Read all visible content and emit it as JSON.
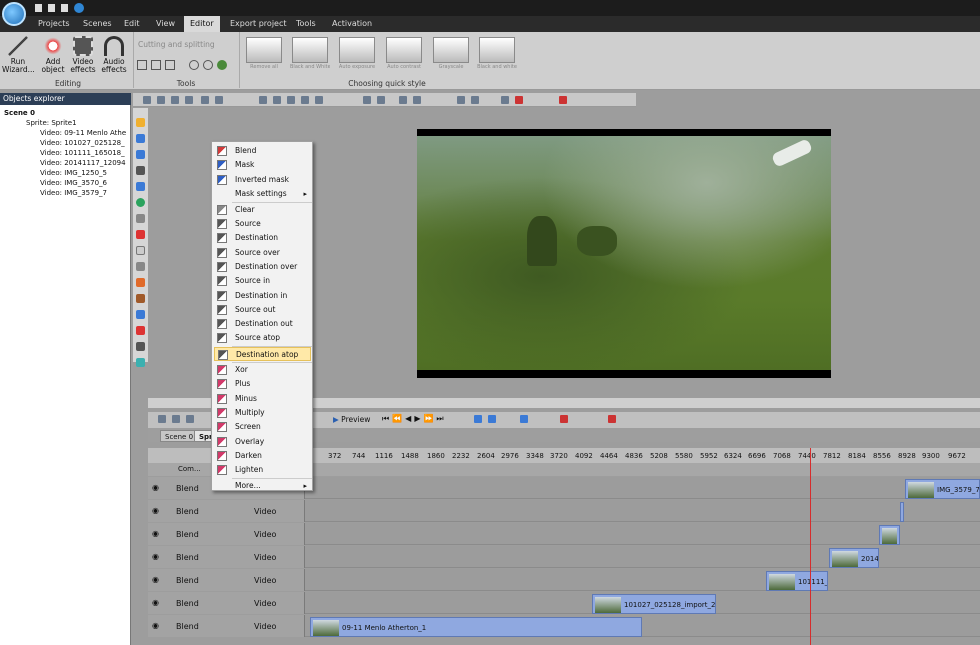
{
  "menu": {
    "tabs": [
      "Projects",
      "Scenes",
      "Edit",
      "View",
      "Editor",
      "Export project",
      "Tools",
      "Activation"
    ],
    "active": "Editor"
  },
  "ribbon": {
    "run_wizard": "Run Wizard...",
    "add_object": "Add object",
    "video_effects": "Video effects",
    "audio_effects": "Audio effects",
    "group_editing": "Editing",
    "cutting": "Cutting and splitting",
    "group_tools": "Tools",
    "group_style": "Choosing quick style",
    "style_thumbs": [
      "Remove all",
      "Black and White",
      "Auto exposure",
      "Auto contrast",
      "Grayscale",
      "Black and white"
    ]
  },
  "explorer": {
    "title": "Objects explorer",
    "scene": "Scene 0",
    "sprite": "Sprite: Sprite1",
    "videos": [
      "Video: 09-11 Menlo Athe",
      "Video: 101027_025128_",
      "Video: 101111_165018_",
      "Video: 20141117_12094",
      "Video: IMG_1250_5",
      "Video: IMG_3570_6",
      "Video: IMG_3579_7"
    ]
  },
  "context_menu": {
    "items": [
      {
        "label": "Blend",
        "color": "#d23a3a"
      },
      {
        "label": "Mask",
        "color": "#2f5fc4"
      },
      {
        "label": "Inverted mask",
        "color": "#2f5fc4"
      },
      {
        "label": "Mask settings",
        "submenu": true,
        "color": ""
      },
      {
        "label": "Clear",
        "color": "#888888"
      },
      {
        "label": "Source",
        "color": "#555555"
      },
      {
        "label": "Destination",
        "color": "#555555"
      },
      {
        "label": "Source over",
        "color": "#555555"
      },
      {
        "label": "Destination over",
        "color": "#555555"
      },
      {
        "label": "Source in",
        "color": "#555555"
      },
      {
        "label": "Destination in",
        "color": "#555555"
      },
      {
        "label": "Source out",
        "color": "#555555"
      },
      {
        "label": "Destination out",
        "color": "#555555"
      },
      {
        "label": "Source atop",
        "color": "#555555"
      },
      {
        "label": "Destination atop",
        "color": "#555555",
        "highlighted": true
      },
      {
        "label": "Xor",
        "color": "#d23a6a"
      },
      {
        "label": "Plus",
        "color": "#d23a6a"
      },
      {
        "label": "Minus",
        "color": "#d23a6a"
      },
      {
        "label": "Multiply",
        "color": "#d23a6a"
      },
      {
        "label": "Screen",
        "color": "#d23a6a"
      },
      {
        "label": "Overlay",
        "color": "#d23a6a"
      },
      {
        "label": "Darken",
        "color": "#d23a6a"
      },
      {
        "label": "Lighten",
        "color": "#d23a6a"
      },
      {
        "label": "More...",
        "submenu": true,
        "color": ""
      }
    ]
  },
  "timeline": {
    "preview_label": "Preview",
    "scene_tabs": [
      "Scene 0",
      "Spr"
    ],
    "ruler": [
      "372",
      "744",
      "1116",
      "1488",
      "1860",
      "2232",
      "2604",
      "2976",
      "3348",
      "3720",
      "4092",
      "4464",
      "4836",
      "5208",
      "5580",
      "5952",
      "6324",
      "6696",
      "7068",
      "7440",
      "7812",
      "8184",
      "8556",
      "8928",
      "9300",
      "9672"
    ],
    "track_header": "Com...",
    "tracks": [
      {
        "blend": "Blend",
        "type": "Video",
        "clip": "IMG_3579_7"
      },
      {
        "blend": "Blend",
        "type": "Video",
        "clip": ""
      },
      {
        "blend": "Blend",
        "type": "Video",
        "clip": ""
      },
      {
        "blend": "Blend",
        "type": "Video",
        "clip": "2014"
      },
      {
        "blend": "Blend",
        "type": "Video",
        "clip": "101111_"
      },
      {
        "blend": "Blend",
        "type": "Video",
        "clip": "101027_025128_import_2"
      },
      {
        "blend": "Blend",
        "type": "Video",
        "clip": "09-11 Menlo Atherton_1"
      }
    ]
  },
  "colors": {
    "accent": "#2c3e56",
    "clip": "#8fa8e0",
    "playhead": "#d62c2c",
    "menu_highlight": "#ffe9a8"
  }
}
